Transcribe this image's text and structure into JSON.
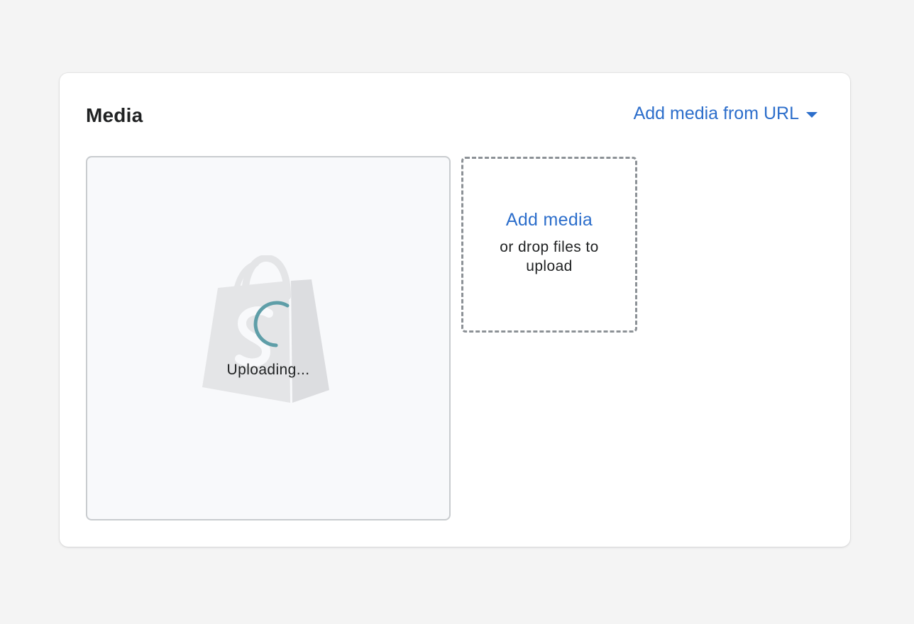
{
  "media_card": {
    "title": "Media",
    "add_from_url_label": "Add media from URL"
  },
  "upload_tile": {
    "status_text": "Uploading..."
  },
  "dropzone": {
    "add_label": "Add media",
    "hint": "or drop files to upload"
  },
  "icons": {
    "bag": "shopify-bag-icon",
    "spinner": "loading-spinner-icon",
    "caret": "caret-down-icon"
  },
  "colors": {
    "link": "#2c6ecb",
    "spinner": "#5e9ea8",
    "background": "#f4f4f4",
    "card": "#ffffff"
  }
}
